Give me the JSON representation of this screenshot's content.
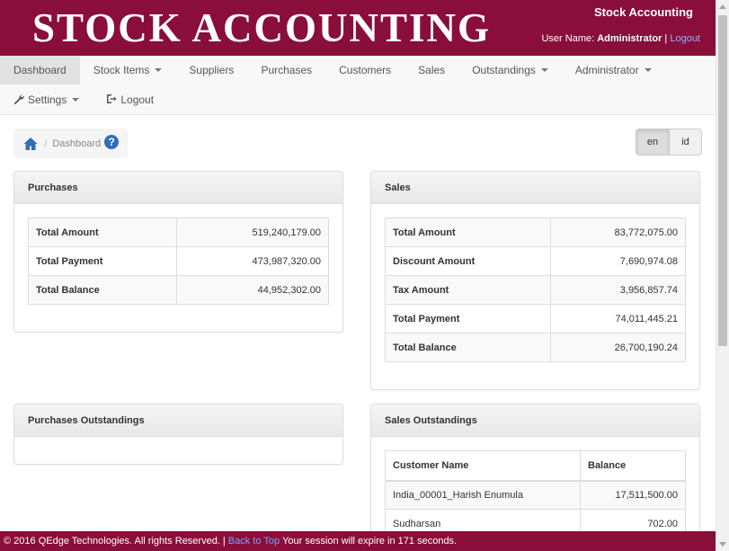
{
  "header": {
    "brand": "STOCK ACCOUNTING",
    "app_name": "Stock Accounting",
    "user_label": "User Name:",
    "user_name": "Administrator",
    "separator": "|",
    "logout": "Logout"
  },
  "nav": {
    "row1": [
      "Dashboard",
      "Stock Items",
      "Suppliers",
      "Purchases",
      "Customers",
      "Sales",
      "Outstandings",
      "Administrator"
    ],
    "settings": "Settings",
    "logout": "Logout"
  },
  "breadcrumb": {
    "separator": "/",
    "current": "Dashboard",
    "help": "?"
  },
  "lang": {
    "en": "en",
    "id": "id"
  },
  "purchases": {
    "title": "Purchases",
    "rows": [
      {
        "label": "Total Amount",
        "value": "519,240,179.00"
      },
      {
        "label": "Total Payment",
        "value": "473,987,320.00"
      },
      {
        "label": "Total Balance",
        "value": "44,952,302.00"
      }
    ]
  },
  "sales": {
    "title": "Sales",
    "rows": [
      {
        "label": "Total Amount",
        "value": "83,772,075.00"
      },
      {
        "label": "Discount Amount",
        "value": "7,690,974.08"
      },
      {
        "label": "Tax Amount",
        "value": "3,956,857.74"
      },
      {
        "label": "Total Payment",
        "value": "74,011,445.21"
      },
      {
        "label": "Total Balance",
        "value": "26,700,190.24"
      }
    ]
  },
  "purchases_outstandings": {
    "title": "Purchases Outstandings"
  },
  "sales_outstandings": {
    "title": "Sales Outstandings",
    "columns": [
      "Customer Name",
      "Balance"
    ],
    "rows": [
      {
        "name": "India_00001_Harish Enumula",
        "balance": "17,511,500.00"
      },
      {
        "name": "Sudharsan",
        "balance": "702.00"
      }
    ]
  },
  "footer": {
    "copyright": "© 2016 QEdge Technologies. All rights Reserved. |",
    "back_to_top": "Back to Top",
    "session": "Your session will expire in 171 seconds."
  },
  "colors": {
    "brand": "#8a0e3a",
    "link": "#2f6fb8"
  }
}
